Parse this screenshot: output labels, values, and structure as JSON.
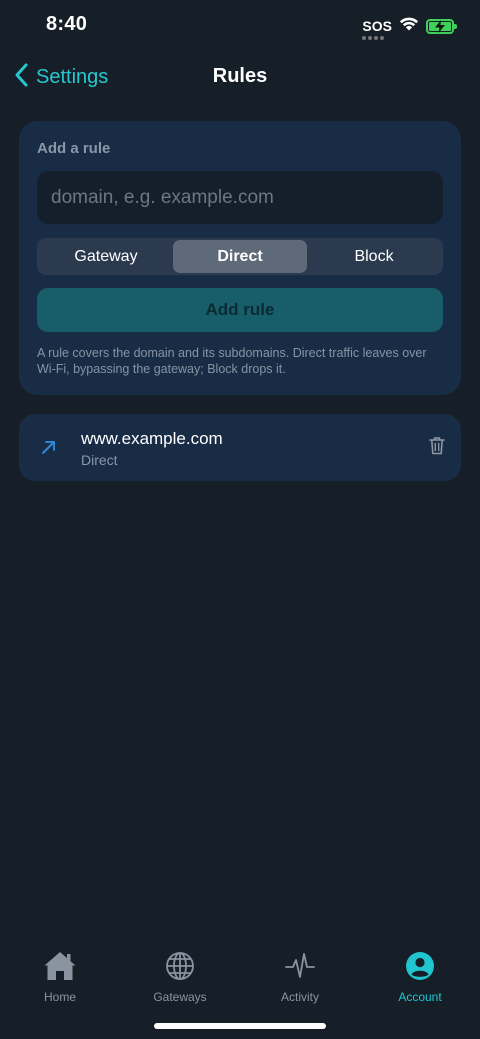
{
  "status_bar": {
    "time": "8:40",
    "sos": "SOS"
  },
  "nav": {
    "back_label": "Settings",
    "title": "Rules"
  },
  "add_rule": {
    "heading": "Add a rule",
    "input_placeholder": "domain, e.g. example.com",
    "input_value": "",
    "modes": [
      "Gateway",
      "Direct",
      "Block"
    ],
    "selected_mode": "Direct",
    "button_label": "Add rule",
    "help_text": "A rule covers the domain and its subdomains. Direct traffic leaves over Wi-Fi, bypassing the gateway; Block drops it."
  },
  "rules": [
    {
      "domain": "www.example.com",
      "type": "Direct",
      "icon": "arrow-up-right-icon"
    }
  ],
  "tabs": [
    {
      "label": "Home",
      "icon": "home-icon",
      "active": false
    },
    {
      "label": "Gateways",
      "icon": "globe-icon",
      "active": false
    },
    {
      "label": "Activity",
      "icon": "pulse-icon",
      "active": false
    },
    {
      "label": "Account",
      "icon": "account-icon",
      "active": true
    }
  ],
  "colors": {
    "background": "#161f28",
    "card": "#192c46",
    "accent": "#27c7cf",
    "button": "#185e6a",
    "battery": "#3fd05a"
  }
}
